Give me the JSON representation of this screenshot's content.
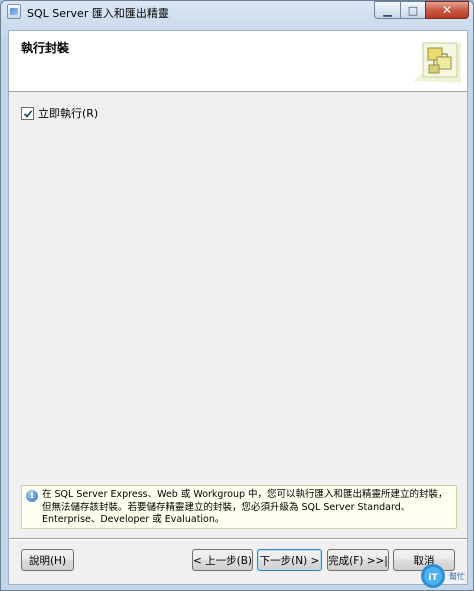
{
  "window": {
    "title": "SQL Server 匯入和匯出精靈",
    "minimize_glyph": "▁",
    "maximize_glyph": "□",
    "close_glyph": "✕"
  },
  "header": {
    "page_title": "執行封裝",
    "graphic_icon": "wizard-package-icon"
  },
  "options": {
    "run_immediately_label": "立即執行(R)",
    "run_immediately_checked": true
  },
  "info": {
    "icon": "info-icon",
    "message": "在 SQL Server Express、Web 或 Workgroup 中，您可以執行匯入和匯出精靈所建立的封裝，但無法儲存該封裝。若要儲存精靈建立的封裝，您必須升級為 SQL Server Standard、Enterprise、Developer 或 Evaluation。"
  },
  "buttons": {
    "help": "說明(H)",
    "back": "< 上一步(B)",
    "next": "下一步(N) >",
    "finish": "完成(F) >>|",
    "cancel": "取消"
  },
  "watermark": {
    "logo_text": "iThome",
    "sub_text": "幫忙"
  }
}
